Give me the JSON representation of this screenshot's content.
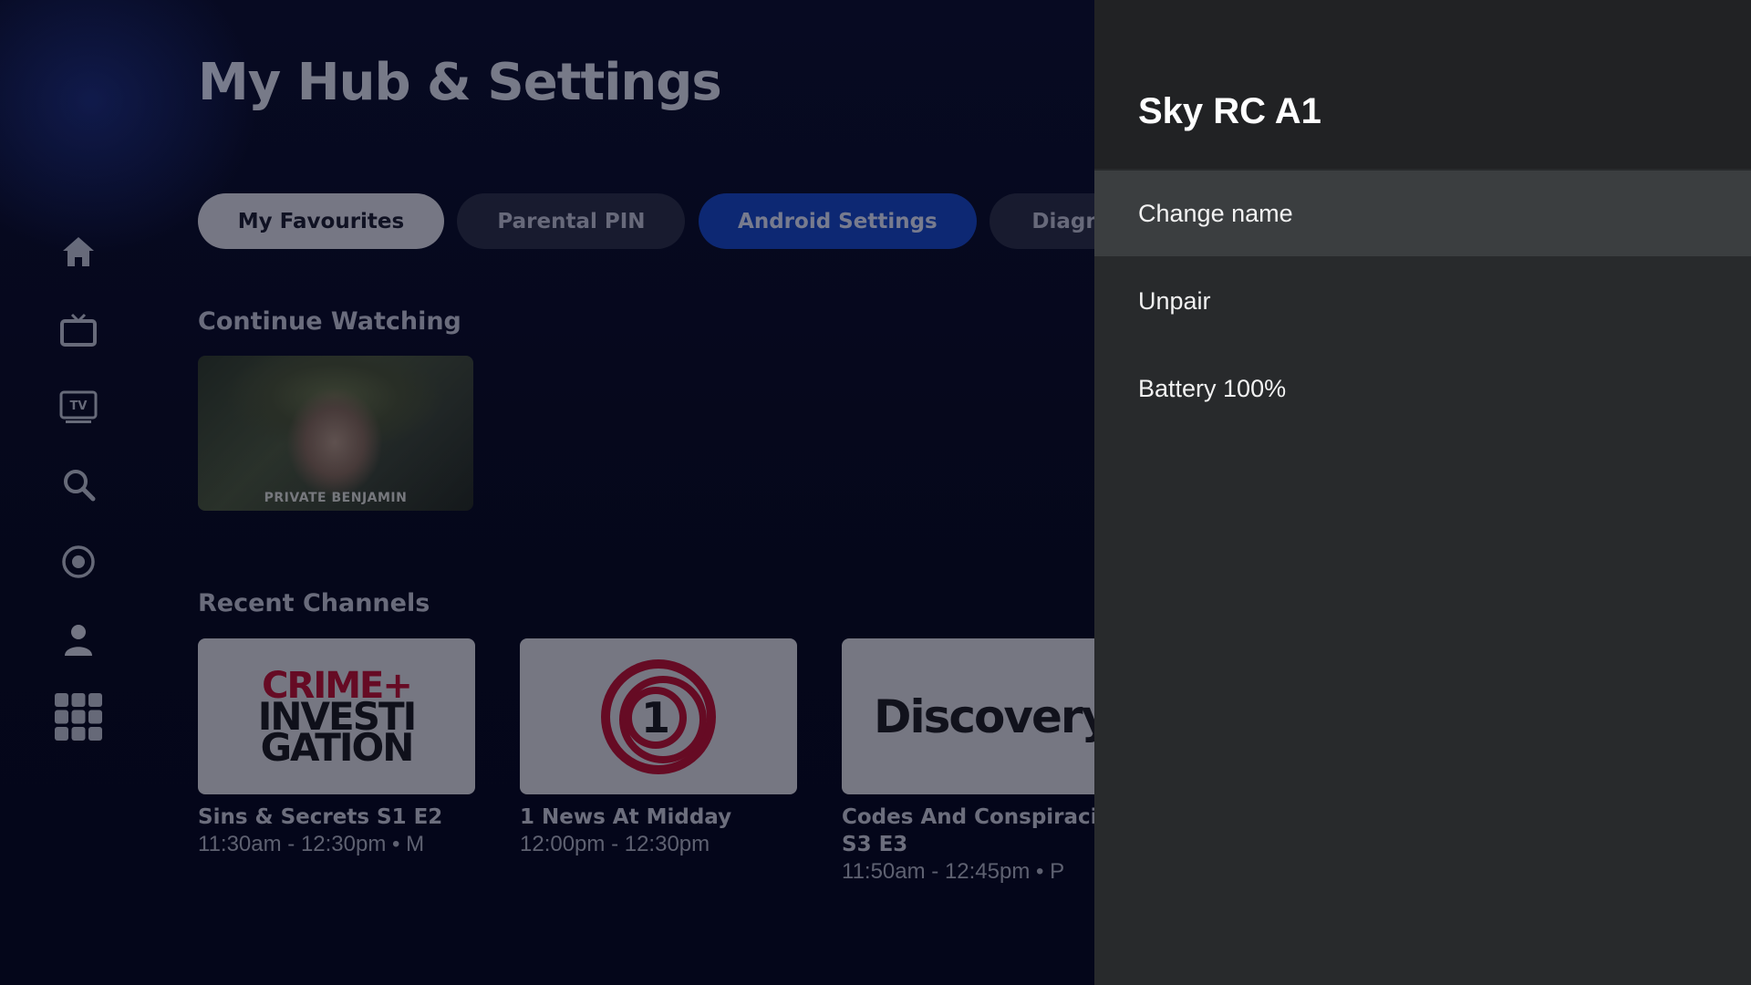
{
  "page": {
    "title": "My Hub & Settings"
  },
  "nav": [
    {
      "name": "home",
      "icon": "home-icon"
    },
    {
      "name": "live-tv",
      "icon": "tv-icon"
    },
    {
      "name": "guide",
      "icon": "tv-guide-icon"
    },
    {
      "name": "search",
      "icon": "search-icon"
    },
    {
      "name": "recordings",
      "icon": "record-icon"
    },
    {
      "name": "profile",
      "icon": "user-icon"
    },
    {
      "name": "apps",
      "icon": "apps-grid-icon"
    }
  ],
  "tabs": [
    {
      "label": "My Favourites"
    },
    {
      "label": "Parental PIN"
    },
    {
      "label": "Android Settings"
    },
    {
      "label": "Diagn"
    }
  ],
  "continue_watching": {
    "title": "Continue Watching",
    "items": [
      {
        "caption": "PRIVATE BENJAMIN"
      }
    ]
  },
  "recent_channels": {
    "title": "Recent Channels",
    "items": [
      {
        "logo_lines": [
          "CRIME+",
          "INVESTI",
          "GATION"
        ],
        "title": "Sins & Secrets S1 E2",
        "time": "11:30am - 12:30pm • M"
      },
      {
        "logo_text": "1",
        "title": "1 News At Midday",
        "time": "12:00pm - 12:30pm"
      },
      {
        "logo_text": "Discovery",
        "title_line1": "Codes And Conspiraci",
        "title_line2": "S3 E3",
        "time": "11:50am - 12:45pm • P"
      }
    ]
  },
  "panel": {
    "title": "Sky RC A1",
    "items": [
      {
        "label": "Change name",
        "focused": true
      },
      {
        "label": "Unpair",
        "focused": false
      },
      {
        "label": "Battery 100%",
        "focused": false
      }
    ]
  },
  "colors": {
    "accent_tab": "#1549c8",
    "panel_bg": "#282a2c",
    "panel_header_bg": "#212224",
    "focus_bg": "#3b3e40",
    "crime_red": "#c8102e",
    "one_news_red": "#c8102e"
  }
}
